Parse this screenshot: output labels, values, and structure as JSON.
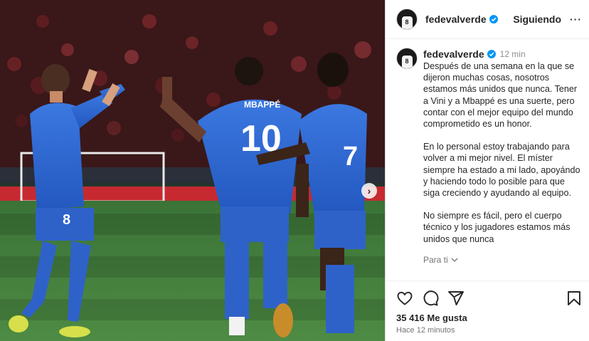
{
  "post": {
    "next_label": "›"
  },
  "header": {
    "avatar_number": "8",
    "username": "fedevalverde",
    "follow_label": "Siguiendo",
    "more_label": "···"
  },
  "caption": {
    "username": "fedevalverde",
    "time": "12 min",
    "paragraphs": [
      "Después de una semana en la que se dijeron muchas cosas, nosotros estamos más unidos que nunca. Tener a Vini y a Mbappé es una suerte, pero contar con el mejor equipo del mundo comprometido es un honor.",
      "En lo personal estoy trabajando para volver a mi mejor nivel. El míster siempre ha estado a mi lado, apoyándo y haciendo todo lo posible para que siga creciendo y ayudando al equipo.",
      "No siempre es fácil, pero el cuerpo técnico y los jugadores estamos más unidos que nunca"
    ],
    "translate_label": "Para ti"
  },
  "actions": {
    "likes": "35 416 Me gusta",
    "time_ago": "Hace 12 minutos"
  },
  "jerseys": {
    "left_number": "8",
    "center_name": "MBAPPÉ",
    "center_number": "10",
    "right_number": "7"
  },
  "colors": {
    "accent_blue": "#0095f6",
    "kit_blue": "#2f6bd6",
    "pitch_green": "#3f7a3a"
  }
}
